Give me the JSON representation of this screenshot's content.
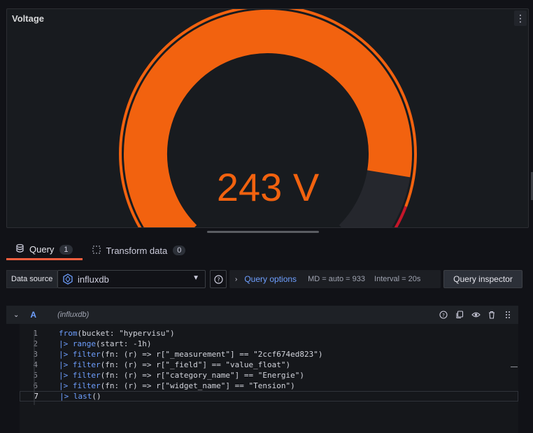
{
  "panel": {
    "title": "Voltage",
    "menu_glyph": "⋮",
    "gauge": {
      "value_text": "243 V",
      "value": 243,
      "min": 0,
      "max": 280,
      "threshold": 255,
      "fill_color": "#f2620f",
      "track_color": "#25272d",
      "threshold_colors": [
        "#f2620f",
        "#c4162a"
      ]
    }
  },
  "tabs": [
    {
      "label": "Query",
      "count": "1",
      "icon": "database-icon"
    },
    {
      "label": "Transform data",
      "count": "0",
      "icon": "transform-icon"
    }
  ],
  "toolbar": {
    "data_source_label": "Data source",
    "data_source_value": "influxdb",
    "query_options_label": "Query options",
    "md": "MD = auto = 933",
    "interval": "Interval = 20s",
    "query_inspector_label": "Query inspector"
  },
  "query": {
    "ref_id": "A",
    "datasource": "(influxdb)"
  },
  "editor": {
    "lines": [
      {
        "num": "1",
        "text": "from(bucket: \"hypervisu\")"
      },
      {
        "num": "2",
        "text": "|> range(start: -1h)"
      },
      {
        "num": "3",
        "text": "|> filter(fn: (r) => r[\"_measurement\"] == \"2ccf674ed823\")"
      },
      {
        "num": "4",
        "text": "|> filter(fn: (r) => r[\"_field\"] == \"value_float\")"
      },
      {
        "num": "5",
        "text": "|> filter(fn: (r) => r[\"category_name\"] == \"Energie\")"
      },
      {
        "num": "6",
        "text": "|> filter(fn: (r) => r[\"widget_name\"] == \"Tension\")"
      },
      {
        "num": "7",
        "text": "|> last()"
      }
    ],
    "current_line": 7
  }
}
